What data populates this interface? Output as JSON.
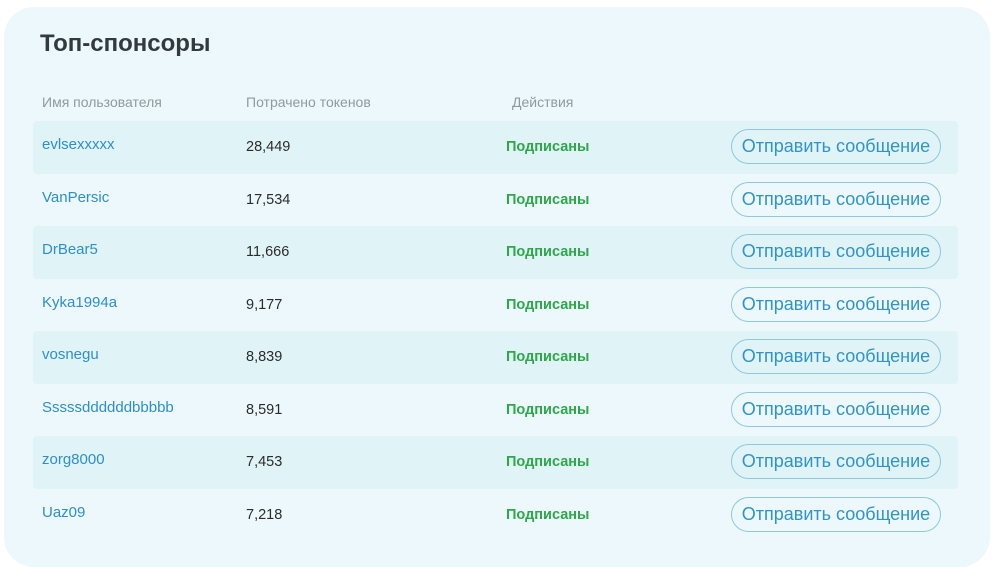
{
  "title": "Топ-спонсоры",
  "table": {
    "headers": [
      "Имя пользователя",
      "Потрачено токенов",
      "Действия"
    ],
    "message_button_label": "Отправить сообщение",
    "rows": [
      {
        "username": "evlsexxxxx",
        "tokens": "28,449",
        "status": "Подписаны"
      },
      {
        "username": "VanPersic",
        "tokens": "17,534",
        "status": "Подписаны"
      },
      {
        "username": "DrBear5",
        "tokens": "11,666",
        "status": "Подписаны"
      },
      {
        "username": "Kyka1994a",
        "tokens": "9,177",
        "status": "Подписаны"
      },
      {
        "username": "vosnegu",
        "tokens": "8,839",
        "status": "Подписаны"
      },
      {
        "username": "Sssssddddddbbbbb",
        "tokens": "8,591",
        "status": "Подписаны"
      },
      {
        "username": "zorg8000",
        "tokens": "7,453",
        "status": "Подписаны"
      },
      {
        "username": "Uaz09",
        "tokens": "7,218",
        "status": "Подписаны"
      }
    ]
  },
  "colors": {
    "panel_background": "#ecf8fc",
    "row_shaded": "#e0f3f7",
    "link": "#2f8fc9",
    "status_green": "#2ea84a",
    "button_border": "#8fc7df"
  }
}
